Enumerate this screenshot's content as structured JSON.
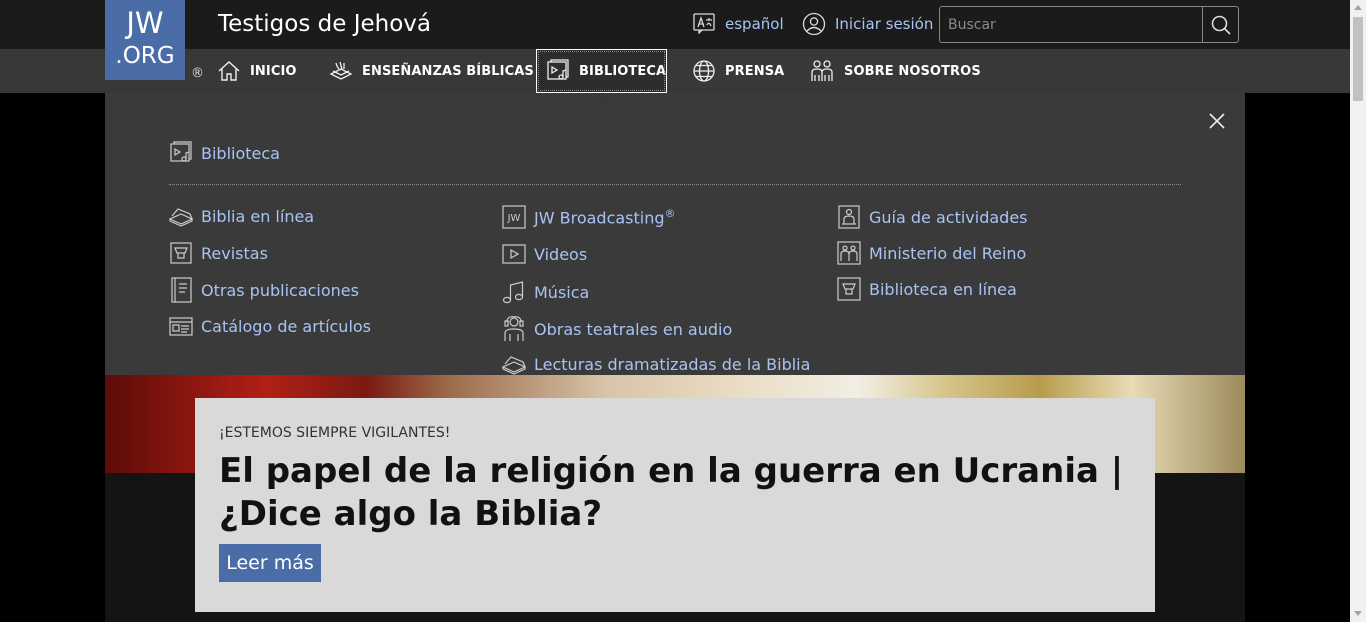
{
  "header": {
    "logo_line1": "JW",
    "logo_line2": ".ORG",
    "registered": "®",
    "site_title": "Testigos de Jehová",
    "language_label": "español",
    "login_label": "Iniciar sesión",
    "search_placeholder": "Buscar"
  },
  "nav": {
    "items": [
      {
        "label": "INICIO",
        "icon": "home-icon"
      },
      {
        "label": "ENSEÑANZAS BÍBLICAS",
        "icon": "bible-teaching-icon"
      },
      {
        "label": "BIBLIOTECA",
        "icon": "library-icon",
        "active": true
      },
      {
        "label": "PRENSA",
        "icon": "globe-icon"
      },
      {
        "label": "SOBRE NOSOTROS",
        "icon": "people-icon"
      }
    ]
  },
  "menu": {
    "heading": "Biblioteca",
    "columns": [
      [
        {
          "label": "Biblia en línea",
          "icon": "open-bible-icon"
        },
        {
          "label": "Revistas",
          "icon": "magazine-icon"
        },
        {
          "label": "Otras publicaciones",
          "icon": "publications-icon"
        },
        {
          "label": "Catálogo de artículos",
          "icon": "catalog-icon"
        }
      ],
      [
        {
          "label": "JW Broadcasting",
          "icon": "jw-broadcasting-icon",
          "sup": "®"
        },
        {
          "label": "Videos",
          "icon": "video-icon"
        },
        {
          "label": "Música",
          "icon": "music-icon"
        },
        {
          "label": "Obras teatrales en audio",
          "icon": "audio-drama-icon"
        },
        {
          "label": "Lecturas dramatizadas de la Biblia",
          "icon": "dramatized-bible-icon"
        }
      ],
      [
        {
          "label": "Guía de actividades",
          "icon": "activity-guide-icon"
        },
        {
          "label": "Ministerio del Reino",
          "icon": "kingdom-ministry-icon"
        },
        {
          "label": "Biblioteca en línea",
          "icon": "online-library-icon"
        }
      ]
    ]
  },
  "hero": {
    "kicker": "¡ESTEMOS SIEMPRE VIGILANTES!",
    "headline": "El papel de la religión en la guerra en Ucrania | ¿Dice algo la Biblia?",
    "cta": "Leer más"
  },
  "colors": {
    "brand": "#4a6da7",
    "link": "#a9c4f2",
    "header_bg": "#1b1b1b",
    "nav_bg": "#383838",
    "panel_bg": "#3a3a3a"
  }
}
